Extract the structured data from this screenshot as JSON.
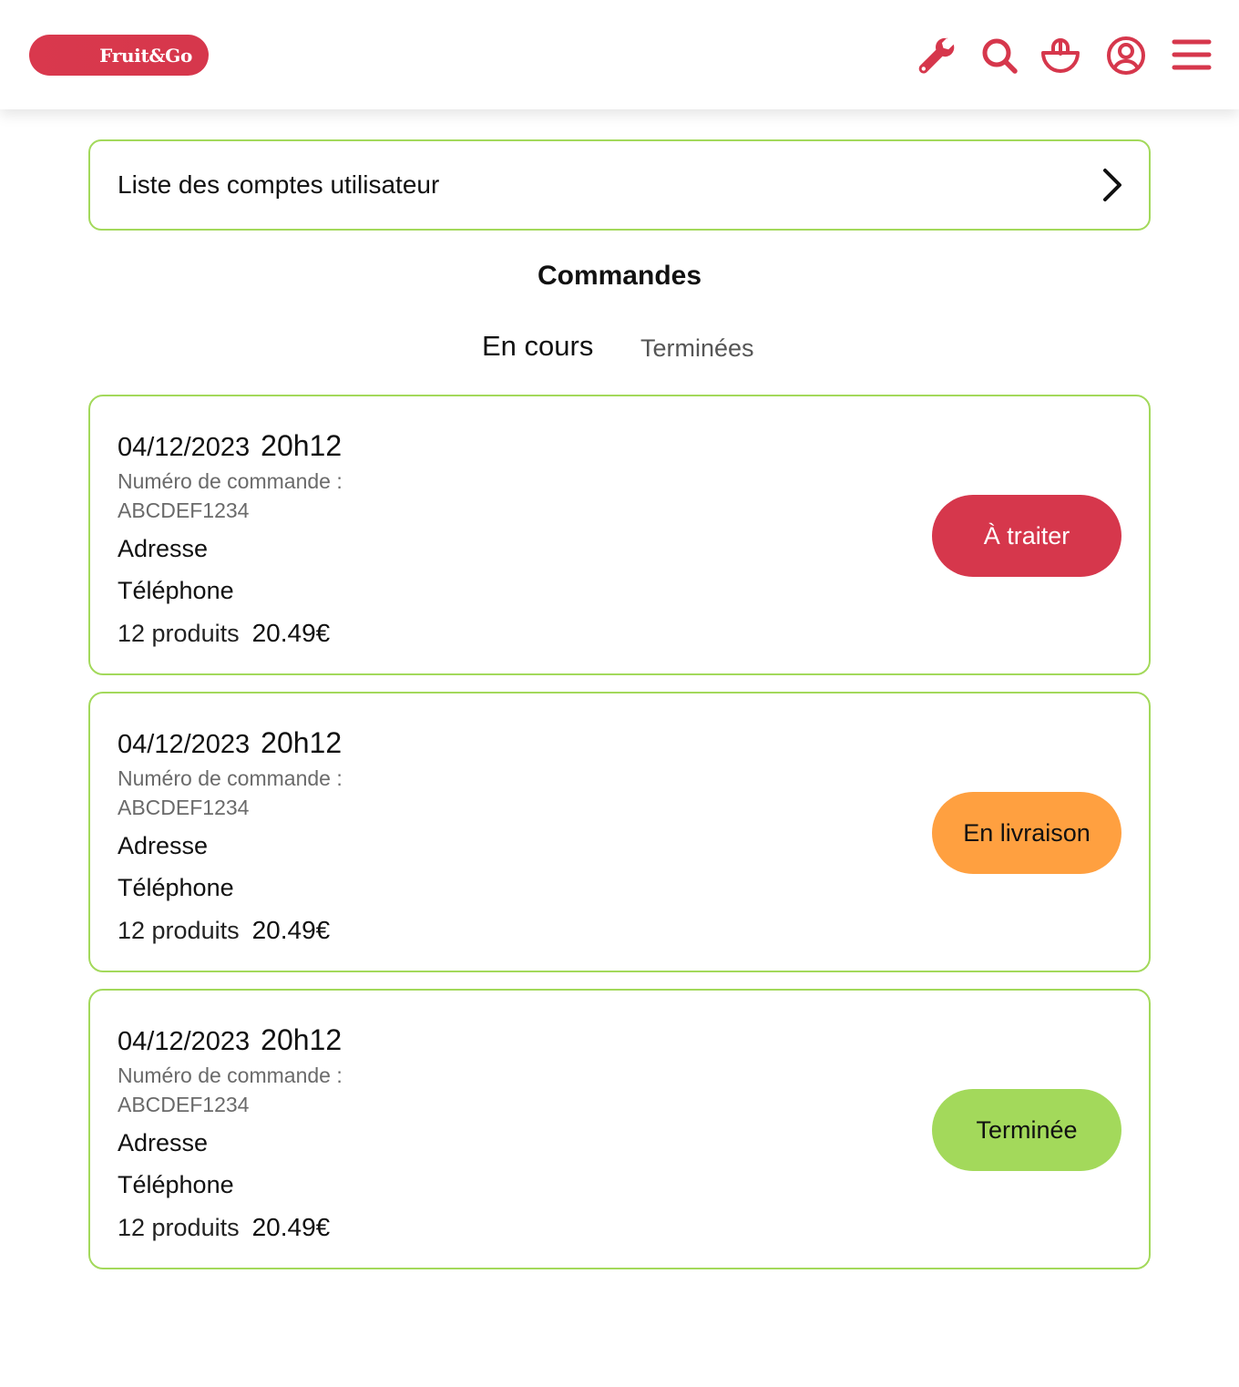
{
  "header": {
    "logo_text": "Fruit&Go",
    "icons": [
      "wrench-icon",
      "search-icon",
      "basket-icon",
      "user-icon",
      "menu-icon"
    ],
    "accent_color": "#d6374c"
  },
  "accounts_link": {
    "label": "Liste des comptes utilisateur"
  },
  "orders_section": {
    "title": "Commandes",
    "tabs": [
      {
        "label": "En cours",
        "active": true
      },
      {
        "label": "Terminées",
        "active": false
      }
    ]
  },
  "orders": [
    {
      "date": "04/12/2023",
      "time": "20h12",
      "number_label": "Numéro de commande :",
      "number": "ABCDEF1234",
      "address": "Adresse",
      "phone": "Téléphone",
      "product_count": "12 produits",
      "total": "20.49€",
      "status": {
        "label": "À traiter",
        "bg": "#d6374c",
        "fg": "#ffffff"
      }
    },
    {
      "date": "04/12/2023",
      "time": "20h12",
      "number_label": "Numéro de commande :",
      "number": "ABCDEF1234",
      "address": "Adresse",
      "phone": "Téléphone",
      "product_count": "12 produits",
      "total": "20.49€",
      "status": {
        "label": "En livraison",
        "bg": "#ffa040",
        "fg": "#111111"
      }
    },
    {
      "date": "04/12/2023",
      "time": "20h12",
      "number_label": "Numéro de commande :",
      "number": "ABCDEF1234",
      "address": "Adresse",
      "phone": "Téléphone",
      "product_count": "12 produits",
      "total": "20.49€",
      "status": {
        "label": "Terminée",
        "bg": "#a3d95b",
        "fg": "#111111"
      }
    }
  ]
}
